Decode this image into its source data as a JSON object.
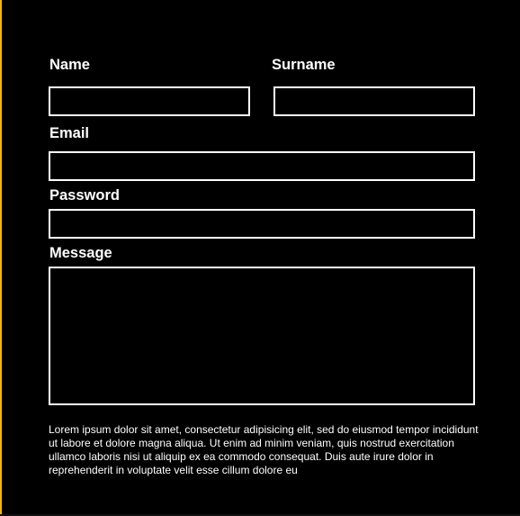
{
  "form": {
    "name_label": "Name",
    "surname_label": "Surname",
    "email_label": "Email",
    "password_label": "Password",
    "message_label": "Message",
    "name_value": "",
    "surname_value": "",
    "email_value": "",
    "password_value": "",
    "message_value": ""
  },
  "footer": {
    "text": "Lorem ipsum dolor sit amet, consectetur adipisicing elit, sed do eiusmod tempor incididunt ut labore et dolore magna aliqua. Ut enim ad minim veniam, quis nostrud exercitation ullamco laboris nisi ut aliquip ex ea commodo consequat. Duis aute irure dolor in reprehenderit in voluptate velit esse cillum dolore eu"
  },
  "colors": {
    "background": "#000000",
    "foreground": "#ffffff",
    "accent": "#f2b705"
  }
}
